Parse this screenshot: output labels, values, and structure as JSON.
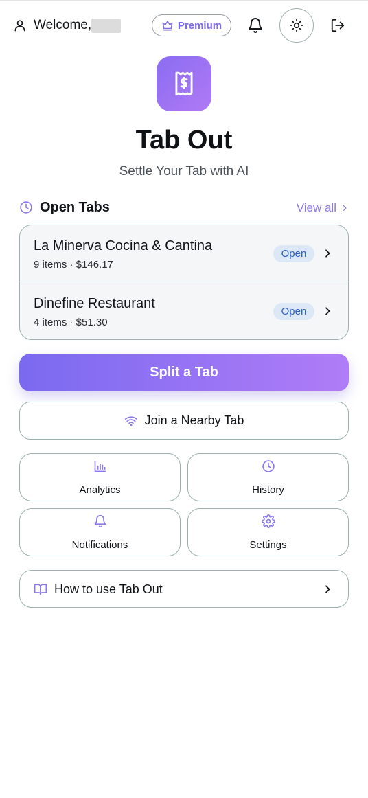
{
  "header": {
    "welcome_label": "Welcome,",
    "premium_label": "Premium"
  },
  "app": {
    "title": "Tab Out",
    "subtitle": "Settle Your Tab with AI"
  },
  "open_tabs": {
    "title": "Open Tabs",
    "view_all_label": "View all",
    "items": [
      {
        "name": "La Minerva Cocina & Cantina",
        "meta": "9 items · $146.17",
        "status": "Open"
      },
      {
        "name": "Dinefine Restaurant",
        "meta": "4 items · $51.30",
        "status": "Open"
      }
    ]
  },
  "actions": {
    "split_label": "Split a Tab",
    "join_label": "Join a Nearby Tab"
  },
  "tiles": [
    {
      "label": "Analytics",
      "icon": "bar-chart-icon"
    },
    {
      "label": "History",
      "icon": "clock-icon"
    },
    {
      "label": "Notifications",
      "icon": "bell-icon"
    },
    {
      "label": "Settings",
      "icon": "gear-icon"
    }
  ],
  "howto": {
    "label": "How to use Tab Out"
  },
  "colors": {
    "accent": "#8b7be8",
    "gradient_start": "#7a6af0",
    "gradient_end": "#b07cf7",
    "badge_bg": "#dde8f6",
    "badge_text": "#2f63c4"
  }
}
